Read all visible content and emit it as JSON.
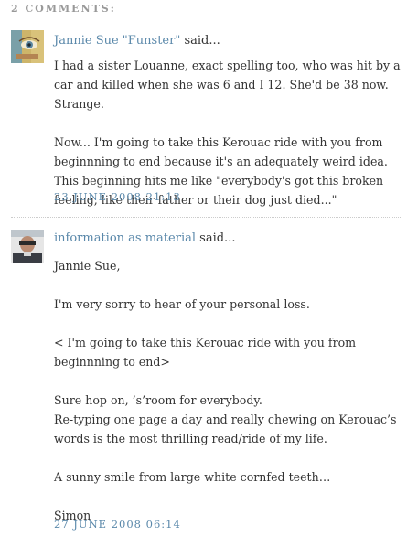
{
  "comments_heading": "2 Comments:",
  "comments": [
    {
      "author": "Jannie Sue \"Funster\"",
      "said": "said...",
      "paragraphs": [
        "I had a sister Louanne, exact spelling too, who was hit by a car and killed when she was 6 and I 12. She'd be 38 now. Strange.",
        "Now... I'm going to take this Kerouac ride with you from beginnning to end because it's an adequately weird idea. This beginning hits me like \"everybody's got this broken feeling, like their father or their dog just died...\""
      ],
      "timestamp": "23 June 2008 21:13"
    },
    {
      "author": "information as material",
      "said": "said...",
      "paragraphs": [
        "Jannie Sue,",
        "I'm very sorry to hear of your personal loss.",
        "< I'm going to take this Kerouac ride with you from beginnning to end>",
        "Sure hop on, ’s’room for everybody.\nRe-typing one page a day and really chewing on Kerouac’s words is the most thrilling read/ride of my life.",
        "A sunny smile from large white cornfed teeth…",
        "Simon"
      ],
      "timestamp": "27 June 2008 06:14"
    }
  ],
  "icons": {
    "avatar1": "portrait-eye-icon",
    "avatar2": "person-photo-icon"
  }
}
